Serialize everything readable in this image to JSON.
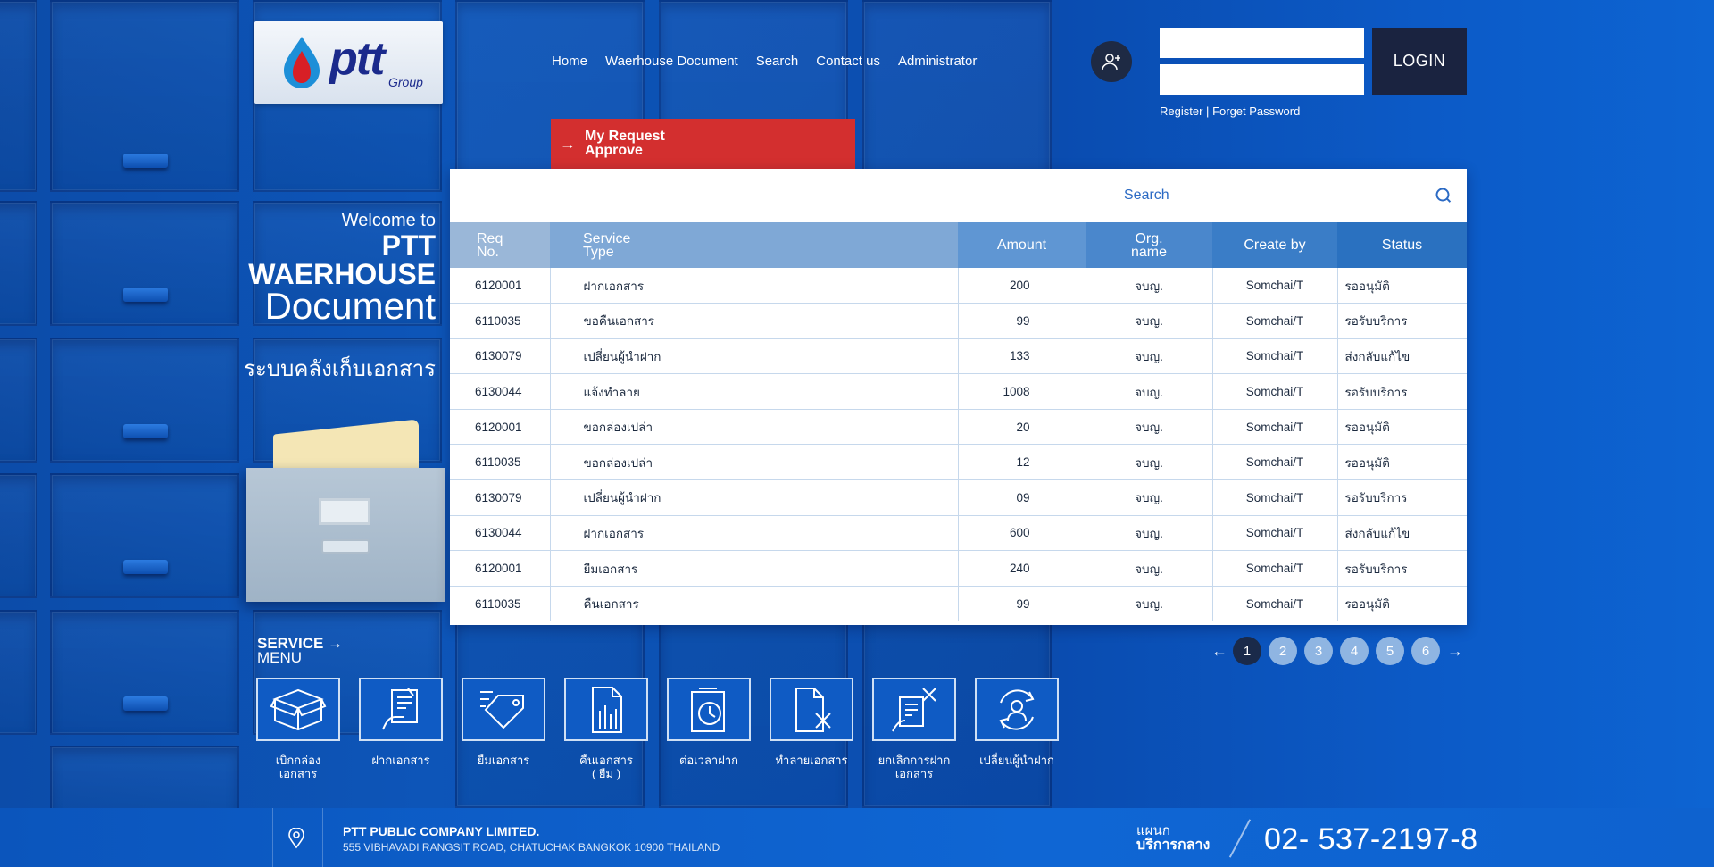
{
  "logo": {
    "text": "ptt",
    "sub": "Group"
  },
  "nav": {
    "items": [
      "Home",
      "Waerhouse Document",
      "Search",
      "Contact us",
      "Administrator"
    ]
  },
  "login": {
    "username_placeholder": "",
    "password_placeholder": "",
    "button_label": "LOGIN",
    "register_label": "Register",
    "separator": "|",
    "forget_label": "Forget Password"
  },
  "welcome": {
    "line1": "Welcome to",
    "line2": "PTT",
    "line3": "WAERHOUSE",
    "line4": "Document",
    "thai": "ระบบคลังเก็บเอกสาร"
  },
  "request_tab": {
    "line1": "My Request",
    "line2": "Approve",
    "arrow": "→"
  },
  "search": {
    "placeholder": "Search"
  },
  "table": {
    "headers": {
      "req_no_1": "Req",
      "req_no_2": "No.",
      "service_1": "Service",
      "service_2": "Type",
      "amount": "Amount",
      "org_1": "Org.",
      "org_2": "name",
      "create_by": "Create by",
      "status": "Status"
    },
    "rows": [
      {
        "req": "6120001",
        "service": "ฝากเอกสาร",
        "amount": "200",
        "org": "จบญ.",
        "by": "Somchai/T",
        "status": "รออนุมัติ"
      },
      {
        "req": "6110035",
        "service": "ขอคืนเอกสาร",
        "amount": "99",
        "org": "จบญ.",
        "by": "Somchai/T",
        "status": "รอรับบริการ"
      },
      {
        "req": "6130079",
        "service": "เปลี่ยนผู้นำฝาก",
        "amount": "133",
        "org": "จบญ.",
        "by": "Somchai/T",
        "status": "ส่งกลับแก้ไข"
      },
      {
        "req": "6130044",
        "service": "แจ้งทำลาย",
        "amount": "1008",
        "org": "จบญ.",
        "by": "Somchai/T",
        "status": "รอรับบริการ"
      },
      {
        "req": "6120001",
        "service": "ขอกล่องเปล่า",
        "amount": "20",
        "org": "จบญ.",
        "by": "Somchai/T",
        "status": "รออนุมัติ"
      },
      {
        "req": "6110035",
        "service": "ขอกล่องเปล่า",
        "amount": "12",
        "org": "จบญ.",
        "by": "Somchai/T",
        "status": "รออนุมัติ"
      },
      {
        "req": "6130079",
        "service": "เปลี่ยนผู้นำฝาก",
        "amount": "09",
        "org": "จบญ.",
        "by": "Somchai/T",
        "status": "รอรับบริการ"
      },
      {
        "req": "6130044",
        "service": "ฝากเอกสาร",
        "amount": "600",
        "org": "จบญ.",
        "by": "Somchai/T",
        "status": "ส่งกลับแก้ไข"
      },
      {
        "req": "6120001",
        "service": "ยืมเอกสาร",
        "amount": "240",
        "org": "จบญ.",
        "by": "Somchai/T",
        "status": "รอรับบริการ"
      },
      {
        "req": "6110035",
        "service": "คืนเอกสาร",
        "amount": "99",
        "org": "จบญ.",
        "by": "Somchai/T",
        "status": "รออนุมัติ"
      }
    ]
  },
  "pagination": {
    "prev": "←",
    "next": "→",
    "pages": [
      "1",
      "2",
      "3",
      "4",
      "5",
      "6"
    ],
    "current": "1"
  },
  "service_menu": {
    "title1": "SERVICE",
    "title2": "MENU",
    "arrow": "→",
    "items": [
      {
        "icon": "box-icon",
        "label1": "เบิกกล่อง",
        "label2": "เอกสาร"
      },
      {
        "icon": "deposit-document-icon",
        "label1": "ฝากเอกสาร",
        "label2": ""
      },
      {
        "icon": "borrow-tag-icon",
        "label1": "ยืมเอกสาร",
        "label2": ""
      },
      {
        "icon": "return-document-icon",
        "label1": "คืนเอกสาร",
        "label2": "( ยืม )"
      },
      {
        "icon": "extend-clock-icon",
        "label1": "ต่อเวลาฝาก",
        "label2": ""
      },
      {
        "icon": "destroy-document-icon",
        "label1": "ทำลายเอกสาร",
        "label2": ""
      },
      {
        "icon": "cancel-deposit-icon",
        "label1": "ยกเลิกการฝาก",
        "label2": "เอกสาร"
      },
      {
        "icon": "change-depositor-icon",
        "label1": "เปลี่ยนผู้นำฝาก",
        "label2": ""
      }
    ]
  },
  "footer": {
    "company": "PTT PUBLIC COMPANY LIMITED.",
    "address": "555 VIBHAVADI RANGSIT ROAD, CHATUCHAK BANGKOK 10900 THAILAND",
    "dept1": "แผนก",
    "dept2": "บริการกลาง",
    "phone": "02- 537-2197-8"
  },
  "colors": {
    "primary_blue": "#0b4fae",
    "red_tab": "#d32f2f",
    "dark_navy": "#1a2340",
    "active_page": "#1a2a4a"
  }
}
